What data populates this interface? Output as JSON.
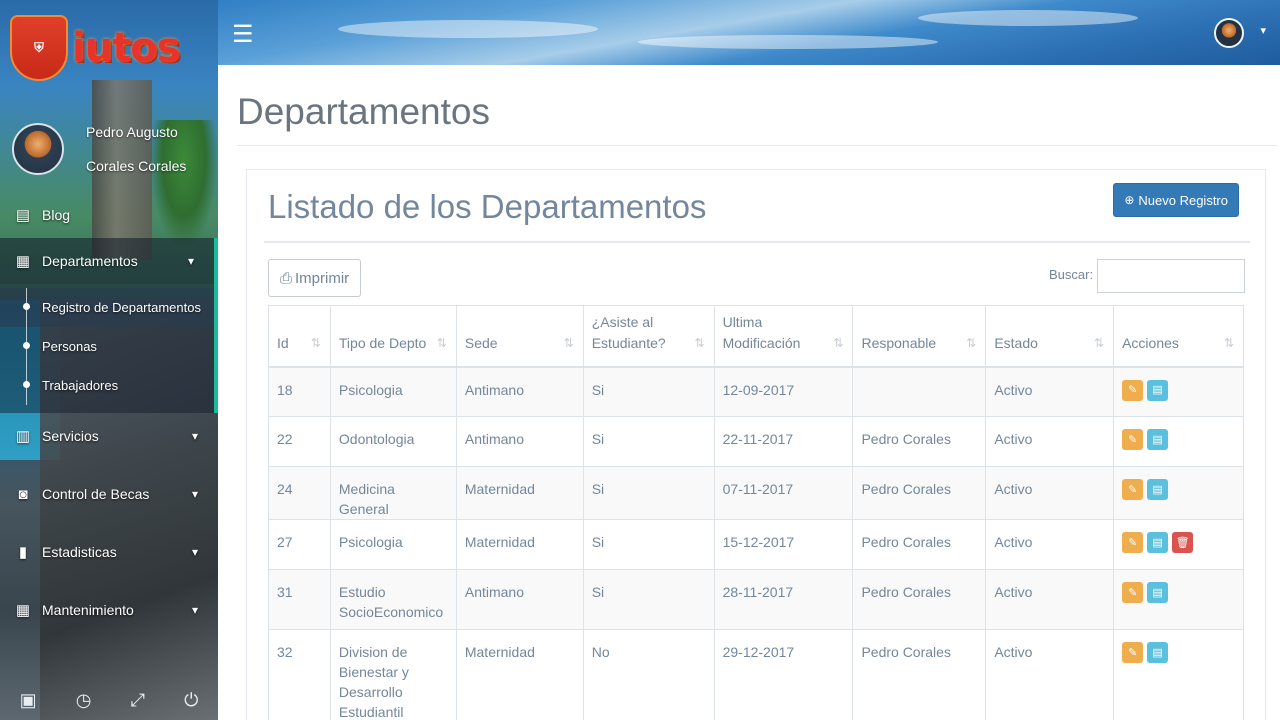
{
  "app": {
    "logo_text": "iutos",
    "user": {
      "first": "Pedro Augusto",
      "last": "Corales Corales"
    }
  },
  "sidebar": {
    "items": [
      {
        "label": "Blog",
        "icon": "book-icon"
      },
      {
        "label": "Departamentos",
        "icon": "building-icon",
        "expanded": true
      },
      {
        "label": "Servicios",
        "icon": "table-icon"
      },
      {
        "label": "Control de Becas",
        "icon": "money-icon"
      },
      {
        "label": "Estadisticas",
        "icon": "bar-chart-icon"
      },
      {
        "label": "Mantenimiento",
        "icon": "grid-icon"
      }
    ],
    "subitems": [
      {
        "label": "Registro de Departamentos"
      },
      {
        "label": "Personas"
      },
      {
        "label": "Trabajadores"
      }
    ],
    "footer_icons": [
      "image-icon",
      "clock-icon",
      "fullscreen-icon",
      "power-icon"
    ]
  },
  "page": {
    "title": "Departamentos",
    "panel_title": "Listado de los Departamentos",
    "new_button": "Nuevo Registro",
    "print_button": "Imprimir",
    "search_label": "Buscar:",
    "search_value": ""
  },
  "table": {
    "columns": [
      "Id",
      "Tipo de Depto",
      "Sede",
      "¿Asiste al Estudiante?",
      "Ultima Modificación",
      "Responable",
      "Estado",
      "Acciones"
    ],
    "rows": [
      {
        "id": "18",
        "tipo": "Psicologia",
        "sede": "Antimano",
        "asiste": "Si",
        "mod": "12-09-2017",
        "resp": "",
        "estado": "Activo",
        "delete": false
      },
      {
        "id": "22",
        "tipo": "Odontologia",
        "sede": "Antimano",
        "asiste": "Si",
        "mod": "22-11-2017",
        "resp": "Pedro Corales",
        "estado": "Activo",
        "delete": false
      },
      {
        "id": "24",
        "tipo": "Medicina General",
        "sede": "Maternidad",
        "asiste": "Si",
        "mod": "07-11-2017",
        "resp": "Pedro Corales",
        "estado": "Activo",
        "delete": false
      },
      {
        "id": "27",
        "tipo": "Psicologia",
        "sede": "Maternidad",
        "asiste": "Si",
        "mod": "15-12-2017",
        "resp": "Pedro Corales",
        "estado": "Activo",
        "delete": true
      },
      {
        "id": "31",
        "tipo": "Estudio SocioEconomico",
        "sede": "Antimano",
        "asiste": "Si",
        "mod": "28-11-2017",
        "resp": "Pedro Corales",
        "estado": "Activo",
        "delete": false
      },
      {
        "id": "32",
        "tipo": "Division de Bienestar y Desarrollo Estudiantil",
        "sede": "Maternidad",
        "asiste": "No",
        "mod": "29-12-2017",
        "resp": "Pedro Corales",
        "estado": "Activo",
        "delete": false
      }
    ]
  },
  "colors": {
    "primary": "#337ab7",
    "edit": "#f0ad4e",
    "view": "#5bc0de",
    "delete": "#d9534f",
    "active_accent": "#1abb9c"
  }
}
